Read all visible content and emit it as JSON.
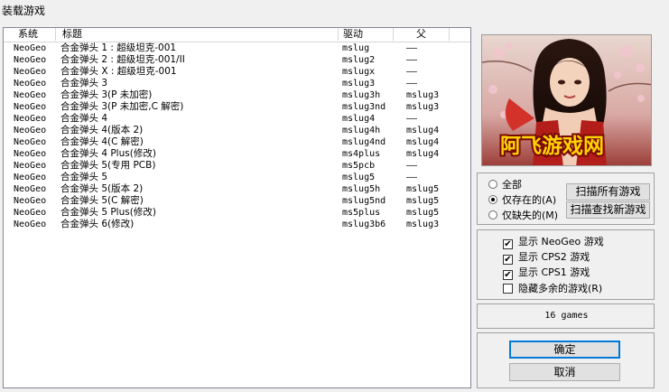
{
  "window": {
    "title": "装载游戏"
  },
  "columns": {
    "system": "系统",
    "title": "标题",
    "driver": "驱动",
    "parent": "父"
  },
  "rows": [
    {
      "system": "NeoGeo",
      "title": "合金弹头 1 : 超级坦克-001",
      "driver": "mslug",
      "parent": "——"
    },
    {
      "system": "NeoGeo",
      "title": "合金弹头 2 : 超级坦克-001/II",
      "driver": "mslug2",
      "parent": "——"
    },
    {
      "system": "NeoGeo",
      "title": "合金弹头 X : 超级坦克-001",
      "driver": "mslugx",
      "parent": "——"
    },
    {
      "system": "NeoGeo",
      "title": "合金弹头 3",
      "driver": "mslug3",
      "parent": "——"
    },
    {
      "system": "NeoGeo",
      "title": "合金弹头 3(P 未加密)",
      "driver": "mslug3h",
      "parent": "mslug3"
    },
    {
      "system": "NeoGeo",
      "title": "合金弹头 3(P 未加密,C 解密)",
      "driver": "mslug3nd",
      "parent": "mslug3"
    },
    {
      "system": "NeoGeo",
      "title": "合金弹头 4",
      "driver": "mslug4",
      "parent": "——"
    },
    {
      "system": "NeoGeo",
      "title": "合金弹头 4(版本 2)",
      "driver": "mslug4h",
      "parent": "mslug4"
    },
    {
      "system": "NeoGeo",
      "title": "合金弹头 4(C 解密)",
      "driver": "mslug4nd",
      "parent": "mslug4"
    },
    {
      "system": "NeoGeo",
      "title": "合金弹头 4 Plus(修改)",
      "driver": "ms4plus",
      "parent": "mslug4"
    },
    {
      "system": "NeoGeo",
      "title": "合金弹头 5(专用 PCB)",
      "driver": "ms5pcb",
      "parent": "——"
    },
    {
      "system": "NeoGeo",
      "title": "合金弹头 5",
      "driver": "mslug5",
      "parent": "——"
    },
    {
      "system": "NeoGeo",
      "title": "合金弹头 5(版本 2)",
      "driver": "mslug5h",
      "parent": "mslug5"
    },
    {
      "system": "NeoGeo",
      "title": "合金弹头 5(C 解密)",
      "driver": "mslug5nd",
      "parent": "mslug5"
    },
    {
      "system": "NeoGeo",
      "title": "合金弹头 5 Plus(修改)",
      "driver": "ms5plus",
      "parent": "mslug5"
    },
    {
      "system": "NeoGeo",
      "title": "合金弹头 6(修改)",
      "driver": "mslug3b6",
      "parent": "mslug3"
    }
  ],
  "preview": {
    "logo_text": "阿飞游戏网"
  },
  "filter": {
    "options": [
      {
        "label": "全部",
        "selected": false
      },
      {
        "label": "仅存在的(A)",
        "selected": true
      },
      {
        "label": "仅缺失的(M)",
        "selected": false
      }
    ],
    "scan_all_label": "扫描所有游戏",
    "scan_new_label": "扫描查找新游戏"
  },
  "display": {
    "checks": [
      {
        "label": "显示 NeoGeo 游戏",
        "checked": true
      },
      {
        "label": "显示 CPS2 游戏",
        "checked": true
      },
      {
        "label": "显示 CPS1 游戏",
        "checked": true
      },
      {
        "label": "隐藏多余的游戏(R)",
        "checked": false
      }
    ]
  },
  "status": {
    "games": "16 games"
  },
  "buttons": {
    "ok": "确定",
    "cancel": "取消"
  },
  "colors": {
    "accent": "#0078d7",
    "logo_yellow": "#ffd400",
    "logo_red": "#c0140c"
  }
}
